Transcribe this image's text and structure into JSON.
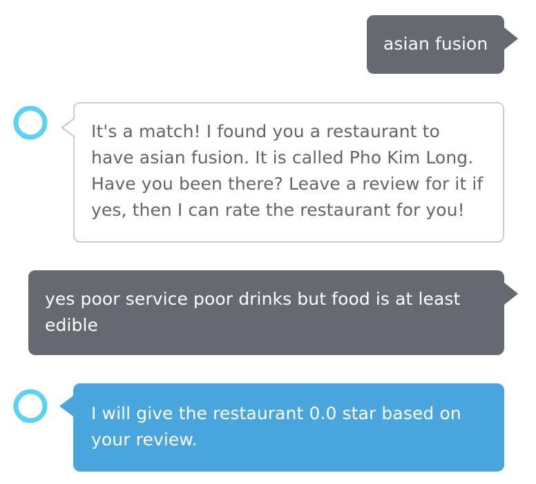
{
  "conversation": {
    "messages": [
      {
        "role": "user",
        "text": "asian fusion"
      },
      {
        "role": "assistant",
        "text": "It's a match! I found you a restaurant to have asian fusion. It is called Pho Kim Long. Have you been there? Leave a review for it if yes, then I can rate the restaurant for you!"
      },
      {
        "role": "user",
        "text": "yes poor service poor drinks but food is at least edible"
      },
      {
        "role": "assistant",
        "text": "I will give the restaurant 0.0 star based on your review."
      }
    ]
  },
  "icons": {
    "assistant_avatar": "alexa-ring-icon"
  },
  "colors": {
    "user_bubble": "#666a70",
    "assistant_outline_border": "#c9ced3",
    "assistant_filled": "#4aa6dd",
    "assistant_text": "#646464",
    "alexa_ring": "#5dd1f2"
  }
}
